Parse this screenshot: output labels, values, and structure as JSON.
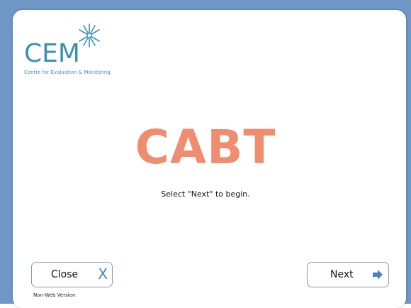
{
  "colors": {
    "frame": "#6e97c6",
    "brand_blue": "#3b8fb4",
    "title_orange": "#f08d71",
    "button_border": "#7d9dbf",
    "icon_blue": "#4a84c1"
  },
  "logo": {
    "name": "CEM",
    "subtitle": "Centre for Evaluation & Monitoring",
    "icon": "star-logo-icon"
  },
  "main": {
    "title": "CABT",
    "instruction": "Select \"Next\" to begin."
  },
  "buttons": {
    "close": {
      "label": "Close",
      "icon_glyph": "X",
      "icon": "close-icon"
    },
    "next": {
      "label": "Next",
      "icon": "arrow-right-icon"
    }
  },
  "footer": {
    "version": "Non-Web Version"
  }
}
